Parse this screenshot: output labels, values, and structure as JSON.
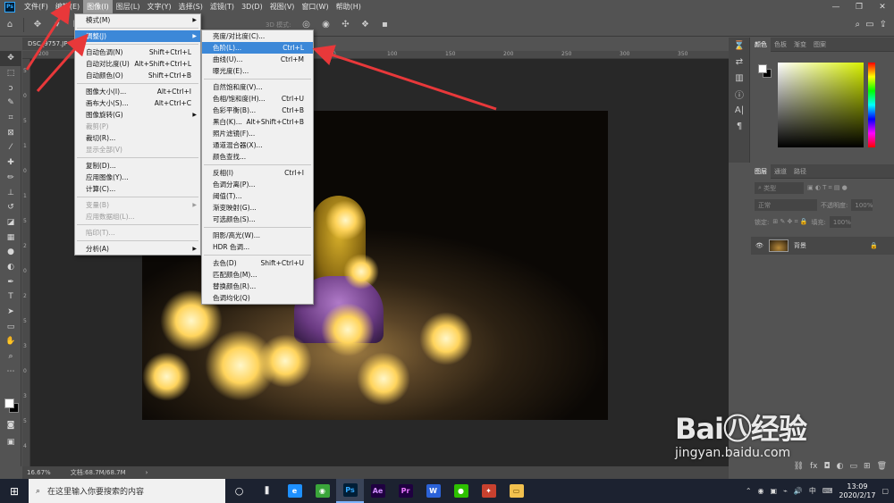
{
  "app": {
    "logo": "Ps"
  },
  "menubar": {
    "items": [
      "文件(F)",
      "编辑(E)",
      "图像(I)",
      "图层(L)",
      "文字(Y)",
      "选择(S)",
      "滤镜(T)",
      "3D(D)",
      "视图(V)",
      "窗口(W)",
      "帮助(H)"
    ],
    "active_index": 2,
    "window_controls": [
      "—",
      "❐",
      "✕"
    ]
  },
  "options_bar": {
    "mode_3d": "3D 模式:"
  },
  "document": {
    "tab_title": "DSC_9757.JP",
    "zoom": "16.67%",
    "doc_info": "文档:68.7M/68.7M",
    "ruler_top": [
      "200",
      "150",
      "100",
      "50",
      "0",
      "50",
      "100",
      "150",
      "200",
      "250",
      "300",
      "350",
      "400"
    ],
    "ruler_left": [
      "5",
      "0",
      "5",
      "1",
      "0",
      "1",
      "5",
      "2",
      "0",
      "2",
      "5",
      "3",
      "0",
      "3",
      "5",
      "4"
    ]
  },
  "image_menu": {
    "items": [
      {
        "label": "模式(M)",
        "submenu": true
      },
      {
        "sep": true
      },
      {
        "label": "调整(J)",
        "submenu": true,
        "highlight": true
      },
      {
        "sep": true
      },
      {
        "label": "自动色调(N)",
        "shortcut": "Shift+Ctrl+L"
      },
      {
        "label": "自动对比度(U)",
        "shortcut": "Alt+Shift+Ctrl+L"
      },
      {
        "label": "自动颜色(O)",
        "shortcut": "Shift+Ctrl+B"
      },
      {
        "sep": true
      },
      {
        "label": "图像大小(I)...",
        "shortcut": "Alt+Ctrl+I"
      },
      {
        "label": "画布大小(S)...",
        "shortcut": "Alt+Ctrl+C"
      },
      {
        "label": "图像旋转(G)",
        "submenu": true
      },
      {
        "label": "裁剪(P)",
        "disabled": true
      },
      {
        "label": "裁切(R)..."
      },
      {
        "label": "显示全部(V)",
        "disabled": true
      },
      {
        "sep": true
      },
      {
        "label": "复制(D)..."
      },
      {
        "label": "应用图像(Y)..."
      },
      {
        "label": "计算(C)..."
      },
      {
        "sep": true
      },
      {
        "label": "变量(B)",
        "submenu": true,
        "disabled": true
      },
      {
        "label": "应用数据组(L)...",
        "disabled": true
      },
      {
        "sep": true
      },
      {
        "label": "陷印(T)...",
        "disabled": true
      },
      {
        "sep": true
      },
      {
        "label": "分析(A)",
        "submenu": true
      }
    ]
  },
  "adjust_menu": {
    "items": [
      {
        "label": "亮度/对比度(C)..."
      },
      {
        "label": "色阶(L)...",
        "shortcut": "Ctrl+L",
        "highlight": true
      },
      {
        "label": "曲线(U)...",
        "shortcut": "Ctrl+M"
      },
      {
        "label": "曝光度(E)..."
      },
      {
        "sep": true
      },
      {
        "label": "自然饱和度(V)..."
      },
      {
        "label": "色相/饱和度(H)...",
        "shortcut": "Ctrl+U"
      },
      {
        "label": "色彩平衡(B)...",
        "shortcut": "Ctrl+B"
      },
      {
        "label": "黑白(K)...",
        "shortcut": "Alt+Shift+Ctrl+B"
      },
      {
        "label": "照片滤镜(F)..."
      },
      {
        "label": "通道混合器(X)..."
      },
      {
        "label": "颜色查找..."
      },
      {
        "sep": true
      },
      {
        "label": "反相(I)",
        "shortcut": "Ctrl+I"
      },
      {
        "label": "色调分离(P)..."
      },
      {
        "label": "阈值(T)..."
      },
      {
        "label": "渐变映射(G)..."
      },
      {
        "label": "可选颜色(S)..."
      },
      {
        "sep": true
      },
      {
        "label": "阴影/高光(W)..."
      },
      {
        "label": "HDR 色调..."
      },
      {
        "sep": true
      },
      {
        "label": "去色(D)",
        "shortcut": "Shift+Ctrl+U"
      },
      {
        "label": "匹配颜色(M)..."
      },
      {
        "label": "替换颜色(R)..."
      },
      {
        "label": "色调均化(Q)"
      }
    ]
  },
  "color_panel": {
    "tabs": [
      "颜色",
      "色板",
      "渐变",
      "图案"
    ]
  },
  "layers_panel": {
    "tabs": [
      "图层",
      "通道",
      "路径"
    ],
    "kind_filter": "类型",
    "blend_mode": "正常",
    "opacity_label": "不透明度:",
    "opacity": "100%",
    "lock_label": "锁定:",
    "fill_label": "填充:",
    "fill": "100%",
    "layer_name": "背景"
  },
  "taskbar": {
    "search_placeholder": "在这里输入你要搜索的内容",
    "apps": [
      {
        "name": "edge",
        "glyph": "e",
        "color": "#1e90ff",
        "text_color": "#ffffff"
      },
      {
        "name": "browser360",
        "glyph": "◉",
        "color": "#3aa53a",
        "text_color": "#ffffff"
      },
      {
        "name": "photoshop",
        "glyph": "Ps",
        "color": "#001e36",
        "text_color": "#31a8ff",
        "active": true
      },
      {
        "name": "after-effects",
        "glyph": "Ae",
        "color": "#1f0040",
        "text_color": "#d291ff"
      },
      {
        "name": "premiere",
        "glyph": "Pr",
        "color": "#1f0040",
        "text_color": "#ea77ff"
      },
      {
        "name": "wps",
        "glyph": "W",
        "color": "#2b62d8",
        "text_color": "#ffffff"
      },
      {
        "name": "wechat",
        "glyph": "●",
        "color": "#2dc100",
        "text_color": "#ffffff"
      },
      {
        "name": "game",
        "glyph": "✦",
        "color": "#c8412f",
        "text_color": "#ffffff"
      },
      {
        "name": "file-explorer",
        "glyph": "▭",
        "color": "#f2c14e",
        "text_color": "#6a4a00"
      }
    ],
    "ime": "中",
    "time": "13:09",
    "date": "2020/2/17"
  },
  "watermark": {
    "logo": "Bai㊇经验",
    "url": "jingyan.baidu.com"
  },
  "colors": {
    "accent": "#3c88d8",
    "annotation": "#e8383a",
    "ps_blue": "#31a8ff"
  }
}
